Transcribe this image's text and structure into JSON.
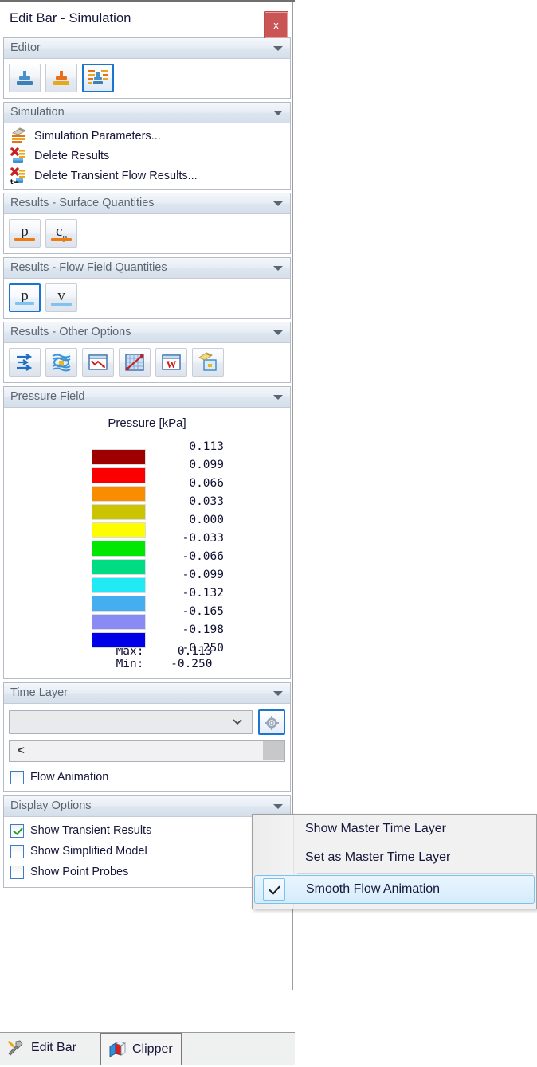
{
  "window": {
    "title": "Edit Bar - Simulation",
    "close_label": "x"
  },
  "groups": {
    "editor": {
      "title": "Editor",
      "buttons": [
        {
          "name": "insert-above-icon",
          "tooltip": "Insert Above",
          "selected": false
        },
        {
          "name": "insert-below-icon",
          "tooltip": "Insert Below",
          "selected": false
        },
        {
          "name": "edit-list-icon",
          "tooltip": "Edit List",
          "selected": true
        }
      ]
    },
    "simulation": {
      "title": "Simulation",
      "commands": [
        {
          "label": "Simulation Parameters...",
          "icon": "simulation-parameters-icon"
        },
        {
          "label": "Delete Results",
          "icon": "delete-results-icon"
        },
        {
          "label": "Delete Transient Flow Results...",
          "icon": "delete-transient-flow-results-icon"
        }
      ]
    },
    "surface_quantities": {
      "title": "Results - Surface Quantities",
      "buttons": [
        {
          "glyph": "p",
          "sub": "",
          "name": "surface-pressure-button",
          "selected": false,
          "bar": "#f07a10"
        },
        {
          "glyph": "c",
          "sub": "p",
          "name": "surface-pressure-coefficient-button",
          "selected": false,
          "bar": "#f07a10"
        }
      ]
    },
    "flow_field_quantities": {
      "title": "Results - Flow Field Quantities",
      "buttons": [
        {
          "glyph": "p",
          "sub": "",
          "name": "flow-pressure-button",
          "selected": true,
          "bar": "#7fc4ee"
        },
        {
          "glyph": "v",
          "sub": "",
          "name": "flow-velocity-button",
          "selected": false,
          "bar": "#7fc4ee"
        }
      ]
    },
    "other_options": {
      "title": "Results - Other Options",
      "buttons": [
        {
          "name": "streamlines-icon",
          "selected": false
        },
        {
          "name": "flow-layers-icon",
          "selected": false
        },
        {
          "name": "chart-curve-icon",
          "selected": false
        },
        {
          "name": "xy-plot-icon",
          "selected": false
        },
        {
          "name": "word-report-icon",
          "selected": false
        },
        {
          "name": "copy-image-icon",
          "selected": false
        }
      ]
    },
    "pressure_field": {
      "title": "Pressure Field"
    },
    "time_layer": {
      "title": "Time Layer",
      "combo_value": "",
      "gear_button_name": "time-layer-settings-button",
      "slider_left_label": "<",
      "flow_animation": {
        "label": "Flow Animation",
        "checked": false
      }
    },
    "display_options": {
      "title": "Display Options",
      "items": [
        {
          "label": "Show Transient Results",
          "checked": true
        },
        {
          "label": "Show Simplified Model",
          "checked": false
        },
        {
          "label": "Show Point Probes",
          "checked": false
        }
      ]
    }
  },
  "context_menu": {
    "items": [
      {
        "label": "Show Master Time Layer",
        "checked": false,
        "highlighted": false
      },
      {
        "label": "Set as Master Time Layer",
        "checked": false,
        "highlighted": false
      },
      {
        "label": "Smooth Flow Animation",
        "checked": true,
        "highlighted": true
      }
    ]
  },
  "tabs": [
    {
      "label": "Edit Bar",
      "icon": "tools-icon",
      "active": false
    },
    {
      "label": "Clipper",
      "icon": "cube-clip-icon",
      "active": true
    }
  ],
  "chart_data": {
    "type": "heatmap",
    "title": "Pressure [kPa]",
    "legend_position": "panel",
    "tick_labels": [
      "0.113",
      "0.099",
      "0.066",
      "0.033",
      "0.000",
      "-0.033",
      "-0.066",
      "-0.099",
      "-0.132",
      "-0.165",
      "-0.198",
      "-0.250"
    ],
    "values": [
      0.113,
      0.099,
      0.066,
      0.033,
      0.0,
      -0.033,
      -0.066,
      -0.099,
      -0.132,
      -0.165,
      -0.198,
      -0.25
    ],
    "band_colors": [
      "#9e0000",
      "#fa0000",
      "#fa8c00",
      "#ccc400",
      "#fdfd00",
      "#00e800",
      "#00dc82",
      "#22eaf5",
      "#45aef0",
      "#8a8af5",
      "#0000e8"
    ],
    "max_label": "Max:",
    "max_value": "0.113",
    "min_label": "Min:",
    "min_value": "-0.250",
    "units": "kPa",
    "ylim": [
      -0.25,
      0.113
    ]
  }
}
